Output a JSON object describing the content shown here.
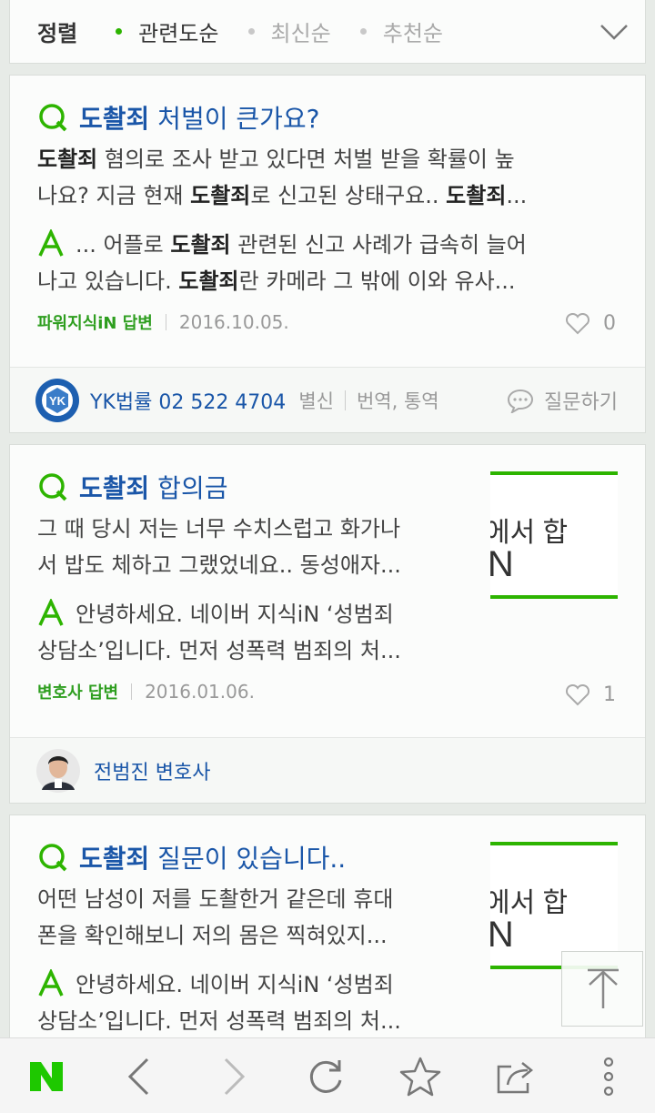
{
  "sort": {
    "title": "정렬",
    "options": [
      "관련도순",
      "최신순",
      "추천순"
    ],
    "active": 0
  },
  "results": [
    {
      "title_kw": "도촬죄",
      "title_rest": " 처벌이 큰가요?",
      "q_line1": [
        [
          "b",
          "도촬죄"
        ],
        [
          "t",
          " 혐의로 조사 받고 있다면 처벌 받을 확률이 높"
        ]
      ],
      "q_line2": [
        [
          "t",
          "나요? 지금 현재 "
        ],
        [
          "b",
          "도촬죄"
        ],
        [
          "t",
          "로 신고된 상태구요.. "
        ],
        [
          "b",
          "도촬죄"
        ],
        [
          "t",
          "..."
        ]
      ],
      "a_line1": [
        [
          "t",
          "... 어플로 "
        ],
        [
          "b",
          "도촬죄"
        ],
        [
          "t",
          " 관련된 신고 사례가 급속히 늘어"
        ]
      ],
      "a_line2": [
        [
          "t",
          "나고 있습니다. "
        ],
        [
          "b",
          "도촬죄"
        ],
        [
          "t",
          "란 카메라 그 밖에 이와 유사..."
        ]
      ],
      "source": "파워지식iN 답변",
      "date": "2016.10.05.",
      "likes": "0",
      "footer": {
        "name": "YK법률 02 522 4704",
        "tags": [
          "별신",
          "번역, 통역"
        ],
        "action": "질문하기"
      }
    },
    {
      "title_kw": "도촬죄",
      "title_rest": " 합의금",
      "q_line1": [
        [
          "t",
          "그 때 당시 저는 너무 수치스럽고 화가나"
        ]
      ],
      "q_line2": [
        [
          "t",
          "서 밥도 체하고 그랬었네요.. 동성애자..."
        ]
      ],
      "a_line1": [
        [
          "t",
          "안녕하세요. 네이버 지식iN ‘성범죄"
        ]
      ],
      "a_line2": [
        [
          "t",
          "상담소’입니다. 먼저 성폭력 범죄의 처..."
        ]
      ],
      "thumb_text": "iN",
      "thumb_text_small": "에서 합",
      "source": "변호사 답변",
      "date": "2016.01.06.",
      "likes": "1",
      "footer": {
        "name": "전범진 변호사"
      }
    },
    {
      "title_kw": "도촬죄",
      "title_rest": " 질문이 있습니다..",
      "q_line1": [
        [
          "t",
          "어떤 남성이 저를 도촬한거 같은데 휴대"
        ]
      ],
      "q_line2": [
        [
          "t",
          "폰을 확인해보니 저의 몸은 찍혀있지..."
        ]
      ],
      "a_line1": [
        [
          "t",
          "안녕하세요. 네이버 지식iN ‘성범죄"
        ]
      ],
      "a_line2": [
        [
          "t",
          "상담소’입니다. 먼저 성폭력 범죄의 처..."
        ]
      ],
      "thumb_text": "iN",
      "thumb_text_small": "에서 합"
    }
  ],
  "icons": {
    "question": "q-icon",
    "answer": "a-icon",
    "like": "heart-icon",
    "comment": "speech-bubble-icon",
    "top": "arrow-up-icon",
    "toolbar": [
      "naver-logo",
      "back-icon",
      "forward-icon",
      "refresh-icon",
      "star-icon",
      "share-icon",
      "more-icon"
    ]
  },
  "colors": {
    "accent": "#2db400",
    "link": "#1a56a8",
    "source_green": "#2e9e1f"
  }
}
